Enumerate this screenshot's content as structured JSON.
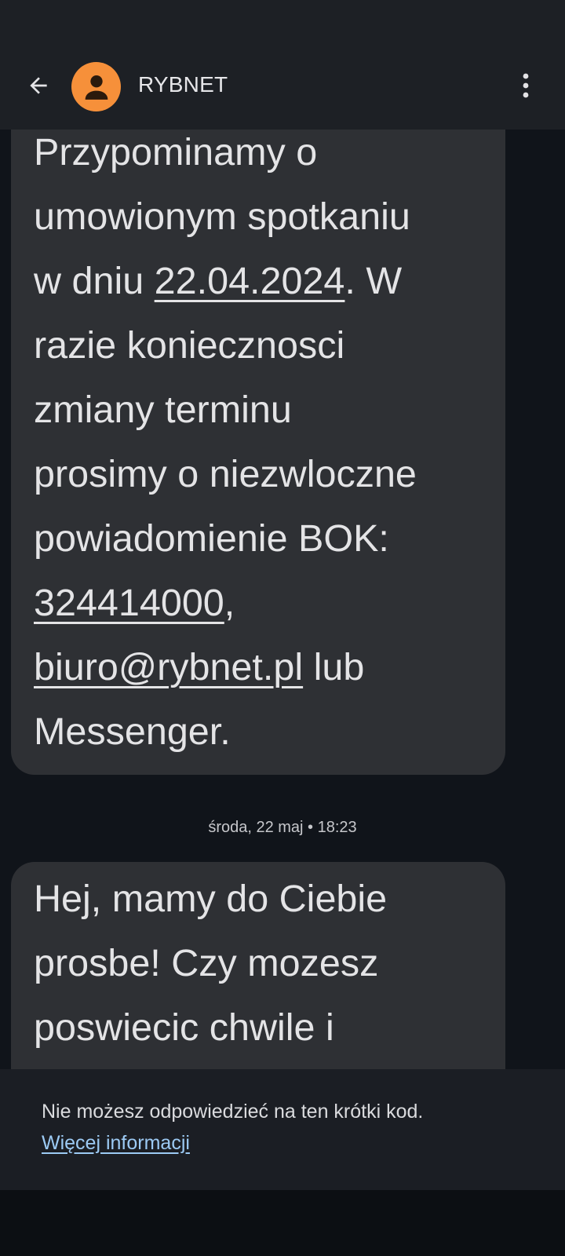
{
  "header": {
    "sender": "RYBNET",
    "avatar_color": "#f6903a",
    "back_icon": "arrow-left-icon",
    "menu_icon": "more-vert-icon"
  },
  "messages": [
    {
      "lines": [
        {
          "parts": [
            {
              "text": "Przypominamy o"
            }
          ]
        },
        {
          "parts": [
            {
              "text": "umowionym spotkaniu"
            }
          ]
        },
        {
          "parts": [
            {
              "text": "w dniu "
            },
            {
              "text": "22.04.2024",
              "link": true
            },
            {
              "text": ". W"
            }
          ]
        },
        {
          "parts": [
            {
              "text": "razie koniecznosci"
            }
          ]
        },
        {
          "parts": [
            {
              "text": "zmiany terminu"
            }
          ]
        },
        {
          "parts": [
            {
              "text": "prosimy o niezwloczne"
            }
          ]
        },
        {
          "parts": [
            {
              "text": "powiadomienie BOK:"
            }
          ]
        },
        {
          "parts": [
            {
              "text": "324414000",
              "link": true
            },
            {
              "text": ","
            }
          ]
        },
        {
          "parts": [
            {
              "text": "biuro@rybnet.pl",
              "link": true
            },
            {
              "text": " lub"
            }
          ]
        },
        {
          "parts": [
            {
              "text": "Messenger."
            }
          ]
        }
      ]
    },
    {
      "lines": [
        {
          "parts": [
            {
              "text": "Hej, mamy do Ciebie"
            }
          ]
        },
        {
          "parts": [
            {
              "text": "prosbe! Czy mozesz"
            }
          ]
        },
        {
          "parts": [
            {
              "text": "poswiecic chwile i"
            }
          ]
        }
      ]
    }
  ],
  "timestamp": "środa, 22 maj • 18:23",
  "footer": {
    "notice": "Nie możesz odpowiedzieć na ten krótki kod.",
    "link_label": "Więcej informacji",
    "link_color": "#9ccaf4"
  }
}
